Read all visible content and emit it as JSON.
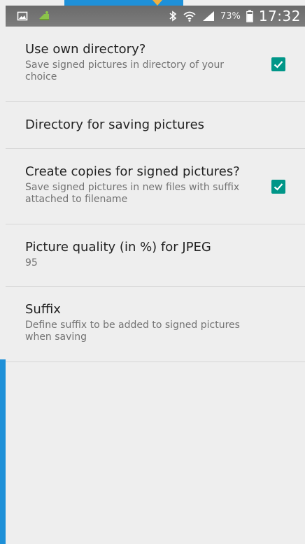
{
  "status_bar": {
    "icons_left": [
      "screenshot-icon",
      "android-debug-icon"
    ],
    "icons_right": [
      "bluetooth-icon",
      "wifi-icon",
      "signal-icon",
      "battery-icon"
    ],
    "battery": "73%",
    "time": "17:32"
  },
  "preferences": [
    {
      "title": "Use own directory?",
      "summary": "Save signed pictures in directory of your choice",
      "checked": true
    },
    {
      "title": "Directory for saving pictures"
    },
    {
      "title": "Create copies for signed pictures?",
      "summary": "Save signed pictures in new files with suffix attached to filename",
      "checked": true
    },
    {
      "title": "Picture quality (in %) for JPEG",
      "summary": "95"
    },
    {
      "title": "Suffix",
      "summary": "Define suffix to be added to signed pictures when saving"
    }
  ],
  "colors": {
    "accent": "#009688",
    "background": "#eeeeee",
    "edge": "#1e90d8"
  }
}
